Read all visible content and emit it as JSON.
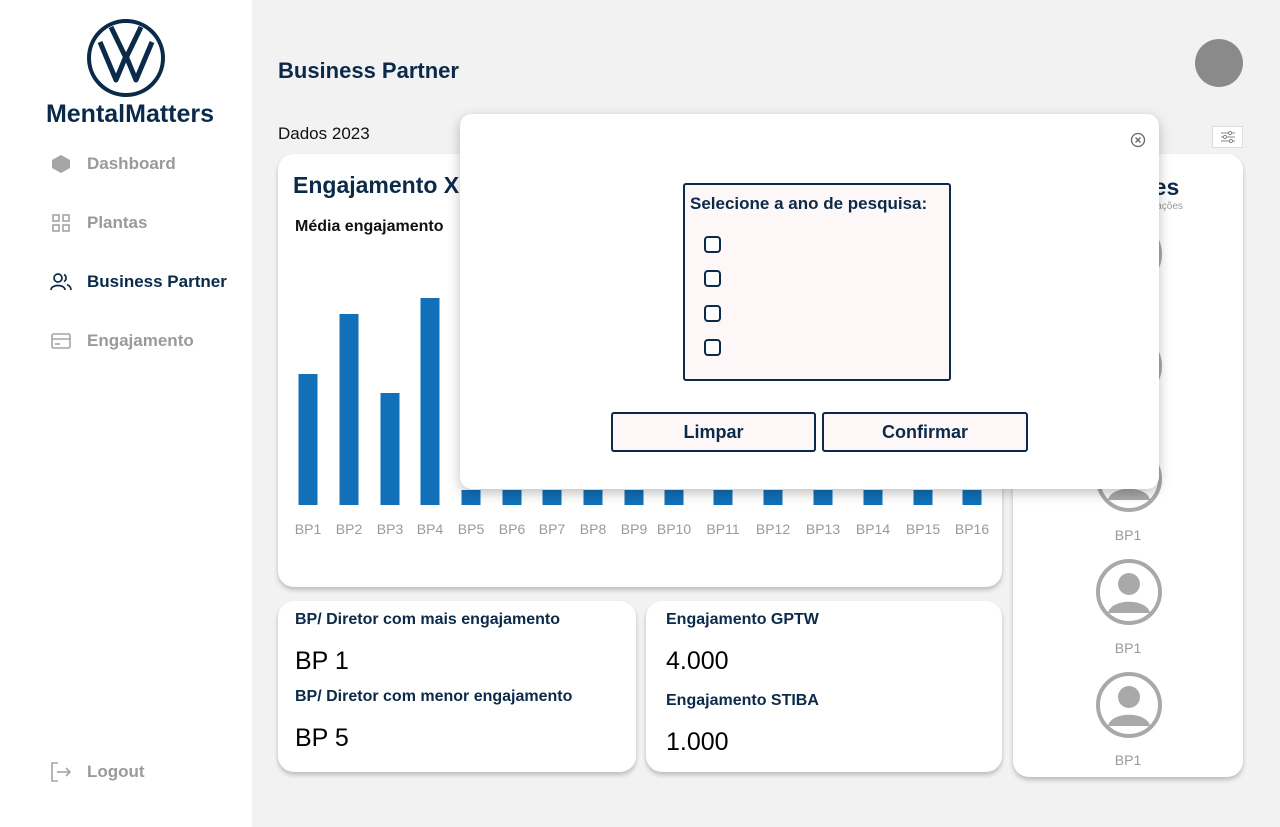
{
  "brand": {
    "name": "MentalMatters",
    "logo": "vw-logo-icon"
  },
  "sidebar": {
    "items": [
      {
        "label": "Dashboard",
        "icon": "layers-icon",
        "active": false
      },
      {
        "label": "Plantas",
        "icon": "grid-icon",
        "active": false
      },
      {
        "label": "Business Partner",
        "icon": "users-icon",
        "active": true
      },
      {
        "label": "Engajamento",
        "icon": "card-icon",
        "active": false
      }
    ],
    "logout_label": "Logout"
  },
  "header": {
    "title": "Business Partner"
  },
  "filter": {
    "dados_label": "Dados 2023"
  },
  "chart_card": {
    "title": "Engajamento X",
    "subtitle": "Média engajamento"
  },
  "chart_data": {
    "type": "bar",
    "categories": [
      "BP1",
      "BP2",
      "BP3",
      "BP4",
      "BP5",
      "BP6",
      "BP7",
      "BP8",
      "BP9",
      "BP10",
      "BP11",
      "BP12",
      "BP13",
      "BP14",
      "BP15",
      "BP16"
    ],
    "values": [
      131,
      191,
      112,
      207,
      15,
      15,
      15,
      15,
      15,
      15,
      15,
      15,
      15,
      15,
      15,
      15
    ],
    "bar_color": "#1170b8"
  },
  "side_card": {
    "title": "tores",
    "subtitle": "ormações",
    "people": [
      {
        "label": ""
      },
      {
        "label": ""
      },
      {
        "label": "BP1"
      },
      {
        "label": "BP1"
      },
      {
        "label": "BP1"
      }
    ]
  },
  "stats_left": {
    "most_label": "BP/ Diretor com mais engajamento",
    "most_value": "BP 1",
    "least_label": "BP/ Diretor com menor engajamento",
    "least_value": "BP 5"
  },
  "stats_right": {
    "gptw_label": "Engajamento GPTW",
    "gptw_value": "4.000",
    "stiba_label": "Engajamento STIBA",
    "stiba_value": "1.000"
  },
  "modal": {
    "title": "Selecione a ano de pesquisa:",
    "options": [
      "",
      "",
      "",
      ""
    ],
    "clear_label": "Limpar",
    "confirm_label": "Confirmar"
  }
}
